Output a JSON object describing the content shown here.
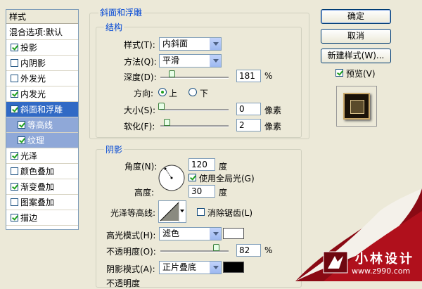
{
  "style_list": {
    "header": "样式",
    "blend_options": "混合选项:默认",
    "items": [
      {
        "label": "投影",
        "checked": true,
        "state": "normal"
      },
      {
        "label": "内阴影",
        "checked": false,
        "state": "normal"
      },
      {
        "label": "外发光",
        "checked": false,
        "state": "normal"
      },
      {
        "label": "内发光",
        "checked": true,
        "state": "normal"
      },
      {
        "label": "斜面和浮雕",
        "checked": true,
        "state": "selected"
      },
      {
        "label": "等高线",
        "checked": true,
        "state": "sub"
      },
      {
        "label": "纹理",
        "checked": true,
        "state": "sub"
      },
      {
        "label": "光泽",
        "checked": true,
        "state": "normal"
      },
      {
        "label": "颜色叠加",
        "checked": false,
        "state": "normal"
      },
      {
        "label": "渐变叠加",
        "checked": true,
        "state": "normal"
      },
      {
        "label": "图案叠加",
        "checked": false,
        "state": "normal"
      },
      {
        "label": "描边",
        "checked": true,
        "state": "normal"
      }
    ]
  },
  "panel": {
    "title": "斜面和浮雕",
    "structure": {
      "title": "结构",
      "style_label": "样式(T):",
      "style_value": "内斜面",
      "technique_label": "方法(Q):",
      "technique_value": "平滑",
      "depth_label": "深度(D):",
      "depth_value": "181",
      "depth_unit": "%",
      "direction_label": "方向:",
      "direction_up": "上",
      "direction_down": "下",
      "size_label": "大小(S):",
      "size_value": "0",
      "size_unit": "像素",
      "soften_label": "软化(F):",
      "soften_value": "2",
      "soften_unit": "像素"
    },
    "shading": {
      "title": "阴影",
      "angle_label": "角度(N):",
      "angle_value": "120",
      "angle_unit": "度",
      "global_light_label": "使用全局光(G)",
      "altitude_label": "高度:",
      "altitude_value": "30",
      "altitude_unit": "度",
      "gloss_contour_label": "光泽等高线:",
      "anti_aliased_label": "消除锯齿(L)",
      "highlight_mode_label": "高光模式(H):",
      "highlight_mode_value": "滤色",
      "highlight_color": "#ffffff",
      "highlight_opacity_label": "不透明度(O):",
      "highlight_opacity_value": "82",
      "highlight_opacity_unit": "%",
      "shadow_mode_label": "阴影模式(A):",
      "shadow_mode_value": "正片叠底",
      "shadow_color": "#000000",
      "shadow_opacity_label": "不透明度"
    }
  },
  "buttons": {
    "ok": "确定",
    "cancel": "取消",
    "new_style": "新建样式(W)...",
    "preview_label": "预览(V)"
  },
  "watermark": {
    "name": "小林设计",
    "url": "www.z990.com"
  }
}
